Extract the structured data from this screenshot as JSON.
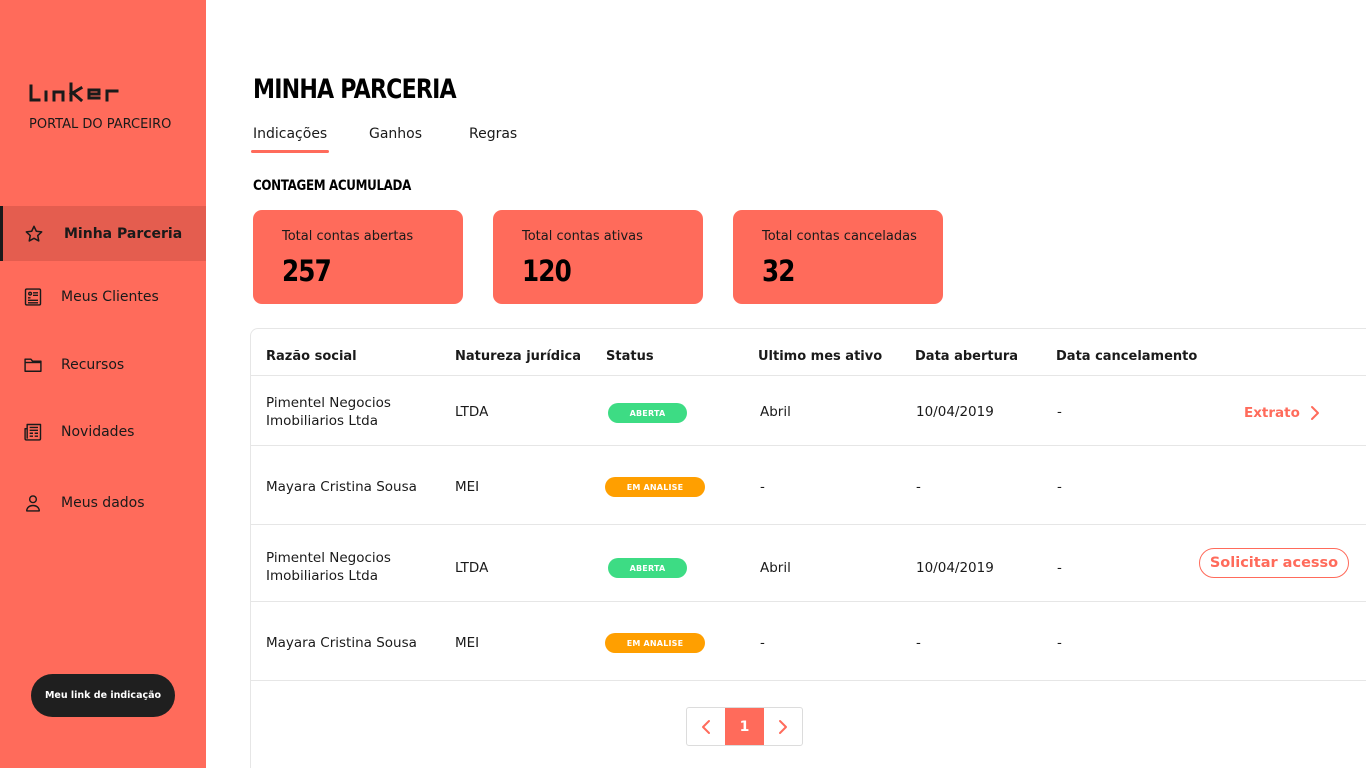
{
  "brand": {
    "logo": "Linker",
    "subtitle": "PORTAL DO PARCEIRO"
  },
  "sidebar": {
    "items": [
      {
        "label": "Minha Parceria",
        "icon": "star-icon",
        "active": true
      },
      {
        "label": "Meus Clientes",
        "icon": "client-list-icon"
      },
      {
        "label": "Recursos",
        "icon": "folder-icon"
      },
      {
        "label": "Novidades",
        "icon": "newspaper-icon"
      },
      {
        "label": "Meus dados",
        "icon": "user-icon"
      }
    ],
    "referral_button": "Meu link de indicação"
  },
  "page": {
    "title": "MINHA PARCERIA",
    "tabs": [
      {
        "label": "Indicações",
        "active": true
      },
      {
        "label": "Ganhos"
      },
      {
        "label": "Regras"
      }
    ],
    "section_title": "CONTAGEM ACUMULADA"
  },
  "stats": [
    {
      "label": "Total contas abertas",
      "value": "257"
    },
    {
      "label": "Total contas ativas",
      "value": "120"
    },
    {
      "label": "Total contas canceladas",
      "value": "32"
    }
  ],
  "table": {
    "headers": [
      "Razão social",
      "Natureza jurídica",
      "Status",
      "Ultimo mes ativo",
      "Data abertura",
      "Data cancelamento"
    ],
    "rows": [
      {
        "name": "Pimentel Negocios Imobiliarios Ltda",
        "nature": "LTDA",
        "status": "ABERTA",
        "status_type": "green",
        "last_month": "Abril",
        "opened": "10/04/2019",
        "cancelled": "-",
        "action": "Extrato"
      },
      {
        "name": "Mayara Cristina Sousa",
        "nature": "MEI",
        "status": "EM ANALISE",
        "status_type": "orange",
        "last_month": "-",
        "opened": "-",
        "cancelled": "-",
        "action": ""
      },
      {
        "name": "Pimentel Negocios Imobiliarios Ltda",
        "nature": "LTDA",
        "status": "ABERTA",
        "status_type": "green",
        "last_month": "Abril",
        "opened": "10/04/2019",
        "cancelled": "-",
        "action": "Solicitar acesso"
      },
      {
        "name": "Mayara Cristina Sousa",
        "nature": "MEI",
        "status": "EM ANALISE",
        "status_type": "orange",
        "last_month": "-",
        "opened": "-",
        "cancelled": "-",
        "action": ""
      }
    ]
  },
  "pagination": {
    "current": "1"
  },
  "colors": {
    "accent": "#ff6b5b",
    "green": "#3ddc84",
    "orange": "#ff9f00",
    "dark": "#1f1f1f"
  }
}
